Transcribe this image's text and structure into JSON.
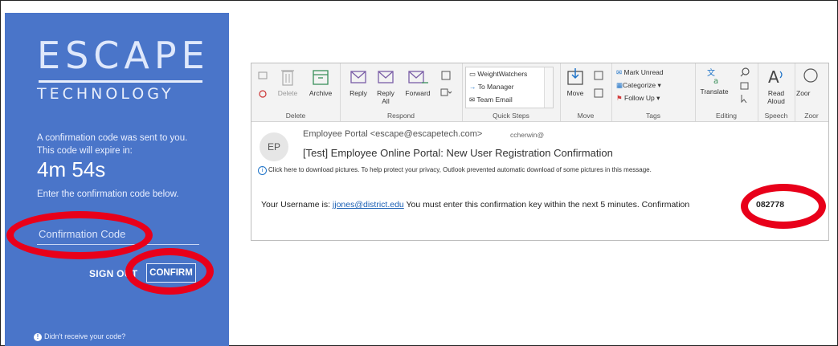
{
  "login": {
    "brand_name": "ESCAPE",
    "brand_sub": "TECHNOLOGY",
    "message_line1": "A confirmation code was sent to you.",
    "message_line2": "This code will expire in:",
    "timer": "4m 54s",
    "instruction": "Enter the confirmation code below.",
    "code_placeholder": "Confirmation Code",
    "sign_out_label": "SIGN OUT",
    "confirm_label": "CONFIRM",
    "help_text": "Didn't receive your code?",
    "panel_color": "#4a75c9"
  },
  "annotation_color": "#e8001a",
  "ribbon": {
    "delete_group": {
      "label": "Delete",
      "delete": "Delete",
      "archive": "Archive"
    },
    "respond_group": {
      "label": "Respond",
      "reply": "Reply",
      "reply_all_line1": "Reply",
      "reply_all_line2": "All",
      "forward": "Forward"
    },
    "quick_steps": {
      "label": "Quick Steps",
      "items": [
        "WeightWatchers",
        "To Manager",
        "Team Email"
      ]
    },
    "move_group": {
      "label": "Move",
      "move": "Move"
    },
    "tags_group": {
      "label": "Tags",
      "mark_unread": "Mark Unread",
      "categorize": "Categorize",
      "follow_up": "Follow Up"
    },
    "editing_group": {
      "label": "Editing",
      "translate": "Translate"
    },
    "speech_group": {
      "label": "Speech",
      "read_aloud_line1": "Read",
      "read_aloud_line2": "Aloud"
    },
    "zoom_group": {
      "label": "Zoor",
      "zoom": "Zoor"
    }
  },
  "email": {
    "avatar_initials": "EP",
    "from": "Employee Portal <escape@escapetech.com>",
    "to": "ccherwin@",
    "subject": "[Test] Employee Online Portal: New User Registration Confirmation",
    "info_bar": "Click here to download pictures. To help protect your privacy, Outlook prevented automatic download of some pictures in this message.",
    "body_prefix": "Your Username is: ",
    "username": "jjones@district.edu",
    "body_suffix": " You must enter this confirmation key within the next 5 minutes. Confirmation",
    "code": "082778"
  }
}
